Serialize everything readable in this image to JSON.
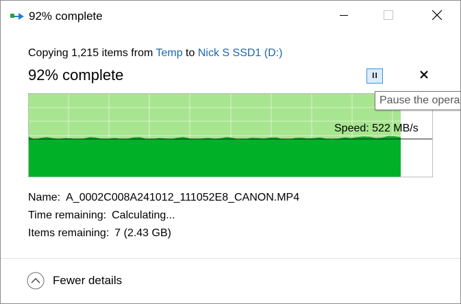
{
  "window": {
    "title": "92% complete",
    "accent": "#1b66b0",
    "icon": "file-transfer-icon"
  },
  "controls": {
    "minimize": "minimize-icon",
    "maximize": "maximize-icon",
    "close": "close-icon"
  },
  "header": {
    "prefix": "Copying 1,215 items from",
    "source": "Temp",
    "connector": "to",
    "destination": "Nick S SSD1 (D:)",
    "progress_title": "92% complete",
    "pause_icon": "pause-icon",
    "cancel_icon": "cancel-icon",
    "tooltip": "Pause the operation"
  },
  "graph": {
    "progress_percent": 92,
    "speed_label": "Speed: 522 MB/s",
    "fill_color": "#00b027",
    "background_color": "#a8e590",
    "remaining_color": "#ffffff"
  },
  "details": {
    "name_label": "Name:",
    "name_value": "A_0002C008A241012_111052E8_CANON.MP4",
    "time_label": "Time remaining:",
    "time_value": "Calculating...",
    "items_label": "Items remaining:",
    "items_value": "7 (2.43 GB)"
  },
  "footer": {
    "toggle_label": "Fewer details",
    "toggle_icon": "chevron-up-icon"
  }
}
